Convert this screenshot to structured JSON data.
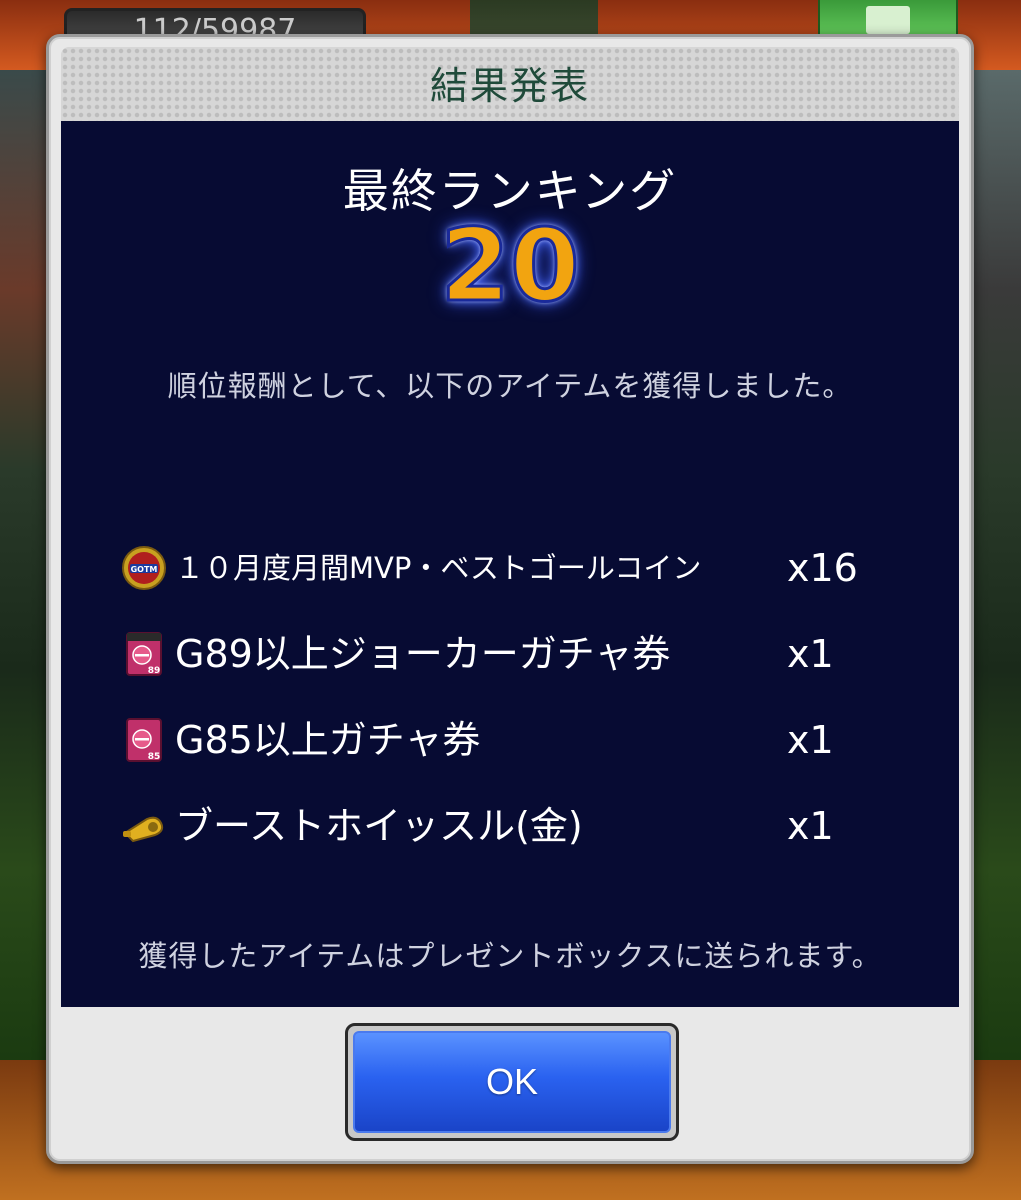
{
  "background": {
    "counter_text": "112/59987"
  },
  "dialog": {
    "title": "結果発表",
    "ranking_label": "最終ランキング",
    "ranking_value": "20",
    "reward_note": "順位報酬として、以下のアイテムを獲得しました。",
    "rewards": [
      {
        "name": "１０月度月間MVP・ベストゴールコイン",
        "quantity": "x16",
        "icon": "gotm-coin-icon"
      },
      {
        "name": "G89以上ジョーカーガチャ券",
        "quantity": "x1",
        "icon": "joker-gacha-ticket-icon"
      },
      {
        "name": "G85以上ガチャ券",
        "quantity": "x1",
        "icon": "gacha-ticket-icon"
      },
      {
        "name": "ブーストホイッスル(金)",
        "quantity": "x1",
        "icon": "gold-whistle-icon"
      }
    ],
    "footer_note": "獲得したアイテムはプレゼントボックスに送られます。",
    "ok_label": "OK"
  },
  "colors": {
    "panel_bg": "#070b33",
    "title_text": "#1f4a3a",
    "rank_gold": "#f2a410",
    "button_blue": "#2a62f0"
  }
}
